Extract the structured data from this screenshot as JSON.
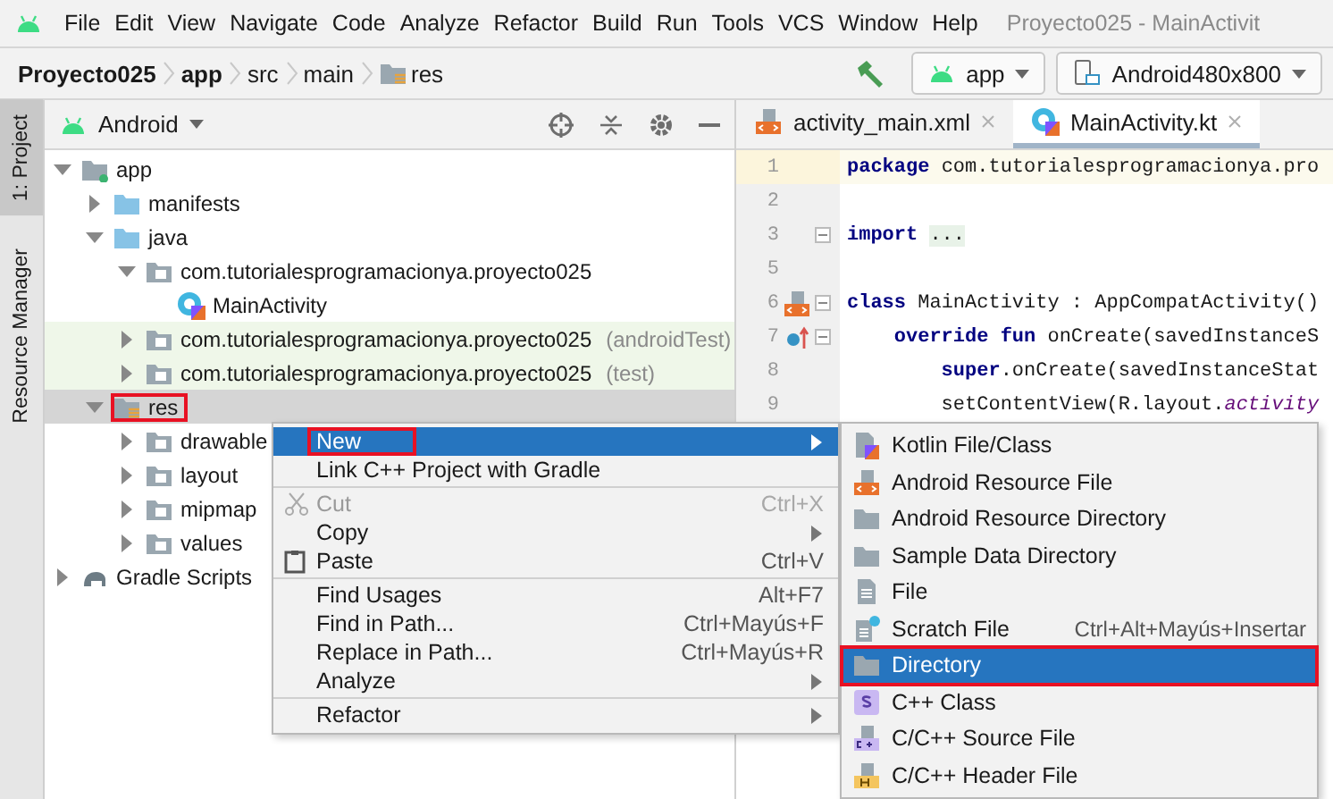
{
  "menu_bar": {
    "items": [
      "File",
      "Edit",
      "View",
      "Navigate",
      "Code",
      "Analyze",
      "Refactor",
      "Build",
      "Run",
      "Tools",
      "VCS",
      "Window",
      "Help"
    ],
    "title": "Proyecto025 - MainActivit"
  },
  "nav_bar": {
    "breadcrumbs": [
      {
        "label": "Proyecto025",
        "kind": "project"
      },
      {
        "label": "app",
        "kind": "module"
      },
      {
        "label": "src",
        "kind": "dir"
      },
      {
        "label": "main",
        "kind": "dir"
      },
      {
        "label": "res",
        "kind": "res"
      }
    ],
    "config": "app",
    "device": "Android480x800"
  },
  "tool_stripe": [
    {
      "label": "1: Project",
      "selected": true
    },
    {
      "label": "Resource Manager",
      "selected": false
    }
  ],
  "project_panel": {
    "view": "Android",
    "tree": [
      {
        "label": "app",
        "kind": "module",
        "expanded": true,
        "selected": false,
        "outlined": false,
        "children": [
          {
            "label": "manifests",
            "kind": "folder",
            "expanded": false,
            "selected": false,
            "outlined": false
          },
          {
            "label": "java",
            "kind": "folder",
            "expanded": true,
            "selected": false,
            "outlined": false,
            "children": [
              {
                "label": "com.tutorialesprogramacionya.proyecto025",
                "kind": "package",
                "expanded": true,
                "selected": false,
                "outlined": false,
                "children": [
                  {
                    "label": "MainActivity",
                    "kind": "class",
                    "selected": false,
                    "outlined": false
                  }
                ]
              },
              {
                "label": "com.tutorialesprogramacionya.proyecto025",
                "suffix": "(androidTest)",
                "kind": "test-package",
                "expanded": false,
                "selected": false,
                "outlined": false
              },
              {
                "label": "com.tutorialesprogramacionya.proyecto025",
                "suffix": "(test)",
                "kind": "test-package",
                "expanded": false,
                "selected": false,
                "outlined": false
              }
            ]
          },
          {
            "label": "res",
            "kind": "res",
            "expanded": true,
            "selected": true,
            "outlined": true,
            "children": [
              {
                "label": "drawable",
                "kind": "package",
                "expanded": false,
                "selected": false,
                "outlined": false
              },
              {
                "label": "layout",
                "kind": "package",
                "expanded": false,
                "selected": false,
                "outlined": false
              },
              {
                "label": "mipmap",
                "kind": "package",
                "expanded": false,
                "selected": false,
                "outlined": false
              },
              {
                "label": "values",
                "kind": "package",
                "expanded": false,
                "selected": false,
                "outlined": false
              }
            ]
          }
        ]
      },
      {
        "label": "Gradle Scripts",
        "kind": "gradle",
        "expanded": false,
        "selected": false,
        "outlined": false
      }
    ]
  },
  "editor": {
    "tabs": [
      {
        "label": "activity_main.xml",
        "kind": "xml",
        "selected": false
      },
      {
        "label": "MainActivity.kt",
        "kind": "kotlin",
        "selected": true
      }
    ],
    "lines": [
      {
        "number": "1",
        "current": true,
        "segments": [
          {
            "text": "package",
            "kind": "keyword"
          },
          {
            "text": " com.tutorialesprogramacionya.pro",
            "kind": "plain"
          }
        ]
      },
      {
        "number": "2",
        "current": false
      },
      {
        "number": "3",
        "current": false,
        "fold": true,
        "segments": [
          {
            "text": "import",
            "kind": "keyword"
          },
          {
            "text": "...",
            "kind": "folded"
          }
        ]
      },
      {
        "number": "5",
        "current": false
      },
      {
        "number": "6",
        "current": false,
        "fold": true,
        "kind": "resource-marker",
        "segments": [
          {
            "text": "class",
            "kind": "keyword"
          },
          {
            "text": " MainActivity : AppCompatActivity()",
            "kind": "plain"
          }
        ]
      },
      {
        "number": "7",
        "current": false,
        "fold": true,
        "kind": "override-marker",
        "segments": [
          {
            "text": "    override fun",
            "kind": "keyword"
          },
          {
            "text": " onCreate(savedInstanceS",
            "kind": "plain"
          }
        ]
      },
      {
        "number": "8",
        "current": false,
        "segments": [
          {
            "text": "        super",
            "kind": "keyword"
          },
          {
            "text": ".onCreate(savedInstanceStat",
            "kind": "plain"
          }
        ]
      },
      {
        "number": "9",
        "current": false,
        "segments": [
          {
            "text": "        setContentView(R.layout.",
            "kind": "plain"
          },
          {
            "text": "activity",
            "kind": "italic"
          }
        ]
      }
    ]
  },
  "context_menu": {
    "groups": [
      [
        {
          "label": "New",
          "submenu": true,
          "selected": true,
          "outlined": true,
          "disabled": false
        },
        {
          "label": "Link C++ Project with Gradle",
          "submenu": false,
          "selected": false,
          "outlined": false,
          "disabled": false
        }
      ],
      [
        {
          "label": "Cut",
          "kind": "cut",
          "shortcut": "Ctrl+X",
          "submenu": false,
          "selected": false,
          "outlined": false,
          "disabled": true
        },
        {
          "label": "Copy",
          "submenu": true,
          "selected": false,
          "outlined": false,
          "disabled": false
        },
        {
          "label": "Paste",
          "kind": "paste",
          "shortcut": "Ctrl+V",
          "submenu": false,
          "selected": false,
          "outlined": false,
          "disabled": false
        }
      ],
      [
        {
          "label": "Find Usages",
          "shortcut": "Alt+F7",
          "submenu": false,
          "selected": false,
          "outlined": false,
          "disabled": false
        },
        {
          "label": "Find in Path...",
          "shortcut": "Ctrl+Mayús+F",
          "submenu": false,
          "selected": false,
          "outlined": false,
          "disabled": false
        },
        {
          "label": "Replace in Path...",
          "shortcut": "Ctrl+Mayús+R",
          "submenu": false,
          "selected": false,
          "outlined": false,
          "disabled": false
        },
        {
          "label": "Analyze",
          "submenu": true,
          "selected": false,
          "outlined": false,
          "disabled": false
        }
      ],
      [
        {
          "label": "Refactor",
          "submenu": true,
          "selected": false,
          "outlined": false,
          "disabled": false
        }
      ]
    ]
  },
  "submenu": {
    "items": [
      {
        "label": "Kotlin File/Class",
        "kind": "kotlin",
        "selected": false,
        "outlined": false
      },
      {
        "label": "Android Resource File",
        "kind": "resource-file",
        "selected": false,
        "outlined": false
      },
      {
        "label": "Android Resource Directory",
        "kind": "folder",
        "selected": false,
        "outlined": false
      },
      {
        "label": "Sample Data Directory",
        "kind": "folder",
        "selected": false,
        "outlined": false
      },
      {
        "label": "File",
        "kind": "file",
        "selected": false,
        "outlined": false
      },
      {
        "label": "Scratch File",
        "kind": "scratch",
        "shortcut": "Ctrl+Alt+Mayús+Insertar",
        "selected": false,
        "outlined": false
      },
      {
        "label": "Directory",
        "kind": "folder",
        "selected": true,
        "outlined": true
      },
      {
        "label": "C++ Class",
        "kind": "cpp-class",
        "selected": false,
        "outlined": false
      },
      {
        "label": "C/C++ Source File",
        "kind": "cpp-source",
        "selected": false,
        "outlined": false
      },
      {
        "label": "C/C++ Header File",
        "kind": "cpp-header",
        "selected": false,
        "outlined": false
      }
    ]
  }
}
